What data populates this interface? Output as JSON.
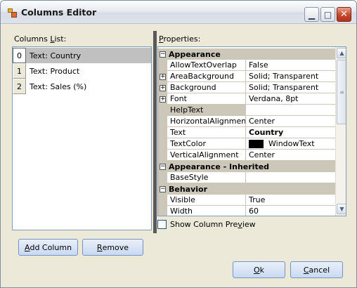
{
  "window": {
    "title": "Columns Editor"
  },
  "columns_list": {
    "label_pre": "Columns ",
    "label_u": "L",
    "label_post": "ist:",
    "items": [
      {
        "index": "0",
        "text": "Text: Country",
        "selected": true
      },
      {
        "index": "1",
        "text": "Text: Product",
        "selected": false
      },
      {
        "index": "2",
        "text": "Text: Sales (%)",
        "selected": false
      }
    ]
  },
  "properties": {
    "label_u": "P",
    "label_post": "roperties:",
    "rows": [
      {
        "type": "category",
        "label": "Appearance",
        "expander": "−"
      },
      {
        "type": "prop",
        "name": "AllowTextOverlap",
        "value": "False"
      },
      {
        "type": "prop",
        "name": "AreaBackground",
        "value": "Solid; Transparent",
        "expander": "+"
      },
      {
        "type": "prop",
        "name": "Background",
        "value": "Solid; Transparent",
        "expander": "+"
      },
      {
        "type": "prop",
        "name": "Font",
        "value": "Verdana, 8pt",
        "expander": "+"
      },
      {
        "type": "prop",
        "name": "HelpText",
        "value": "",
        "selected": true
      },
      {
        "type": "prop",
        "name": "HorizontalAlignment",
        "value": "Center"
      },
      {
        "type": "prop",
        "name": "Text",
        "value": "Country",
        "bold": true
      },
      {
        "type": "prop",
        "name": "TextColor",
        "value": "WindowText",
        "swatch": "#000000"
      },
      {
        "type": "prop",
        "name": "VerticalAlignment",
        "value": "Center"
      },
      {
        "type": "category",
        "label": "Appearance - Inherited",
        "expander": "−"
      },
      {
        "type": "prop",
        "name": "BaseStyle",
        "value": ""
      },
      {
        "type": "category",
        "label": "Behavior",
        "expander": "−"
      },
      {
        "type": "prop",
        "name": "Visible",
        "value": "True"
      },
      {
        "type": "prop",
        "name": "Width",
        "value": "60"
      }
    ]
  },
  "show_preview": {
    "pre": "Show Column Pre",
    "u": "v",
    "post": "iew",
    "checked": false
  },
  "buttons": {
    "add_column": {
      "u": "A",
      "post": "dd Column"
    },
    "remove": {
      "u": "R",
      "post": "emove"
    },
    "ok": {
      "u": "O",
      "post": "k"
    },
    "cancel": {
      "u": "C",
      "post": "ancel"
    }
  }
}
